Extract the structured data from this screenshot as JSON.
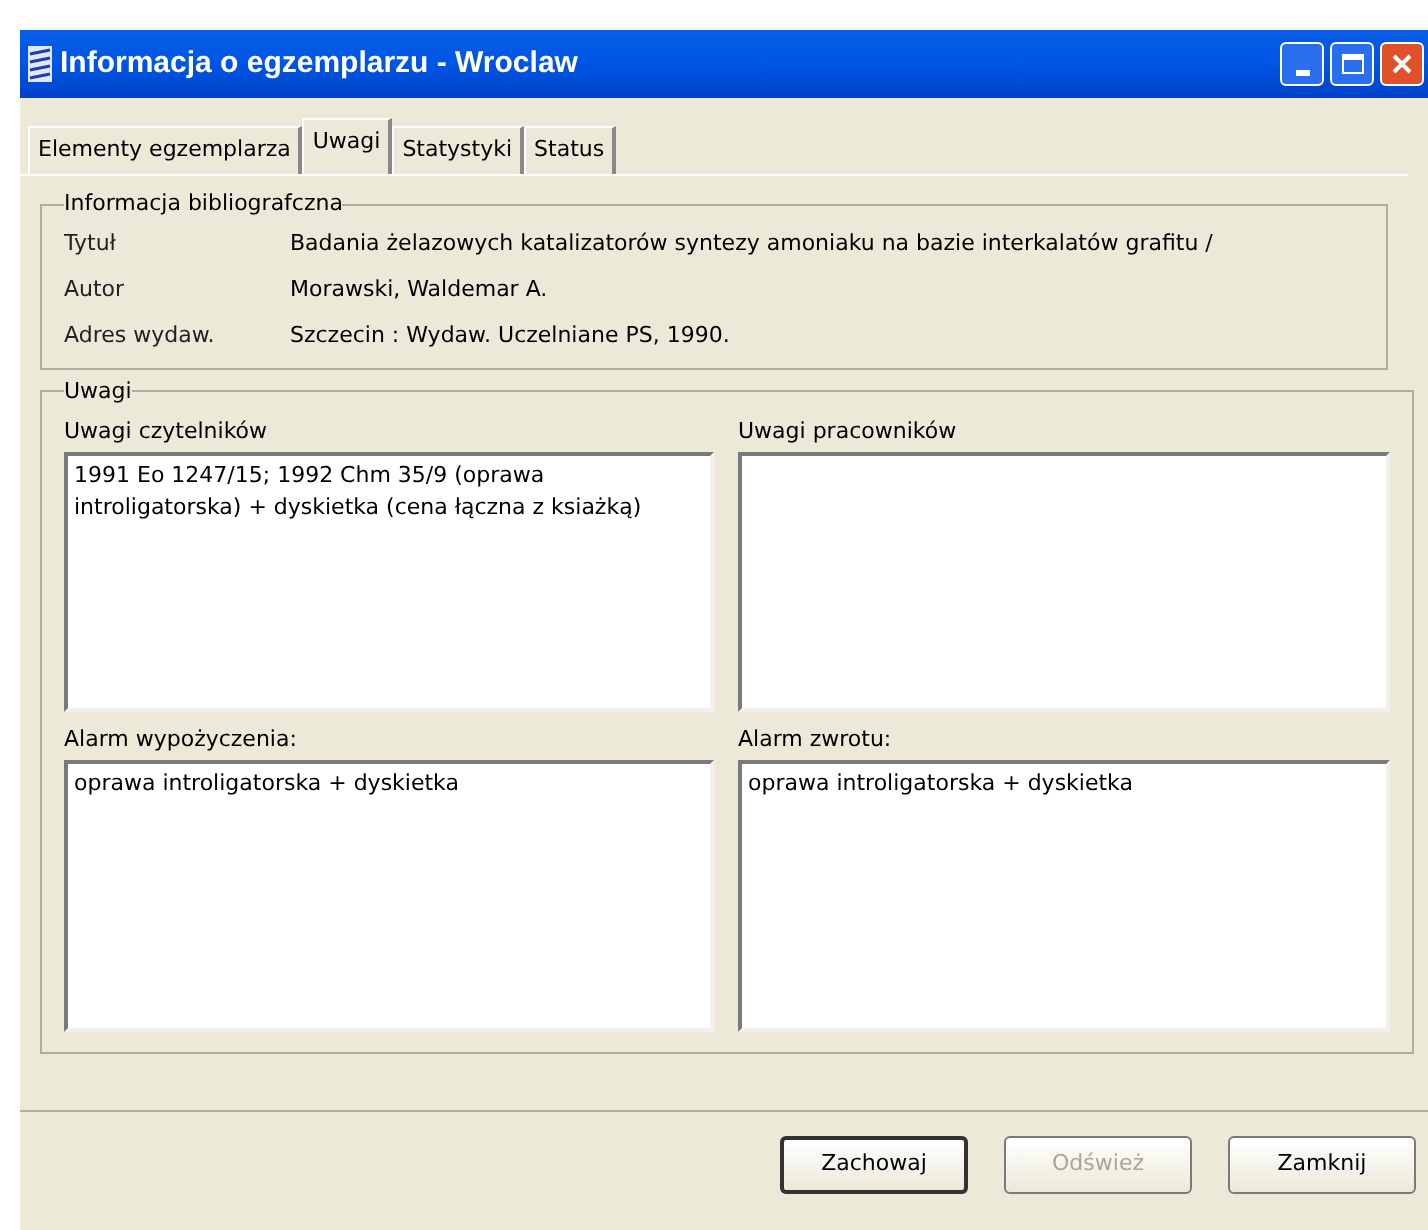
{
  "window": {
    "title": "Informacja o egzemplarzu - Wroclaw"
  },
  "tabs": [
    {
      "label": "Elementy egzemplarza",
      "selected": false
    },
    {
      "label": "Uwagi",
      "selected": true
    },
    {
      "label": "Statystyki",
      "selected": false
    },
    {
      "label": "Status",
      "selected": false
    }
  ],
  "bibliographic_info": {
    "title": "Informacja bibliografczna",
    "rows": [
      {
        "label": "Tytuł",
        "value": "Badania żelazowych katalizatorów syntezy amoniaku na bazie interkalatów grafitu /"
      },
      {
        "label": "Autor",
        "value": "Morawski, Waldemar A."
      },
      {
        "label": "Adres wydaw.",
        "value": "Szczecin : Wydaw. Uczelniane PS, 1990."
      }
    ]
  },
  "notes": {
    "title": "Uwagi",
    "fields": [
      {
        "label": "Uwagi czytelników",
        "value": "1991 Eo 1247/15; 1992 Chm 35/9 (oprawa introligatorska) + dyskietka (cena łączna z ksiażką)"
      },
      {
        "label": "Uwagi pracowników"
      },
      {
        "label": "Alarm wypożyczenia:",
        "value": "oprawa introligatorska + dyskietka"
      },
      {
        "label": "Alarm zwrotu:",
        "value": "oprawa introligatorska + dyskietka"
      }
    ]
  },
  "buttons": [
    {
      "label": "Zachowaj",
      "disabled": false,
      "default": true
    },
    {
      "label": "Odśwież",
      "disabled": true,
      "default": false
    },
    {
      "label": "Zamknij",
      "disabled": false,
      "default": false
    }
  ]
}
